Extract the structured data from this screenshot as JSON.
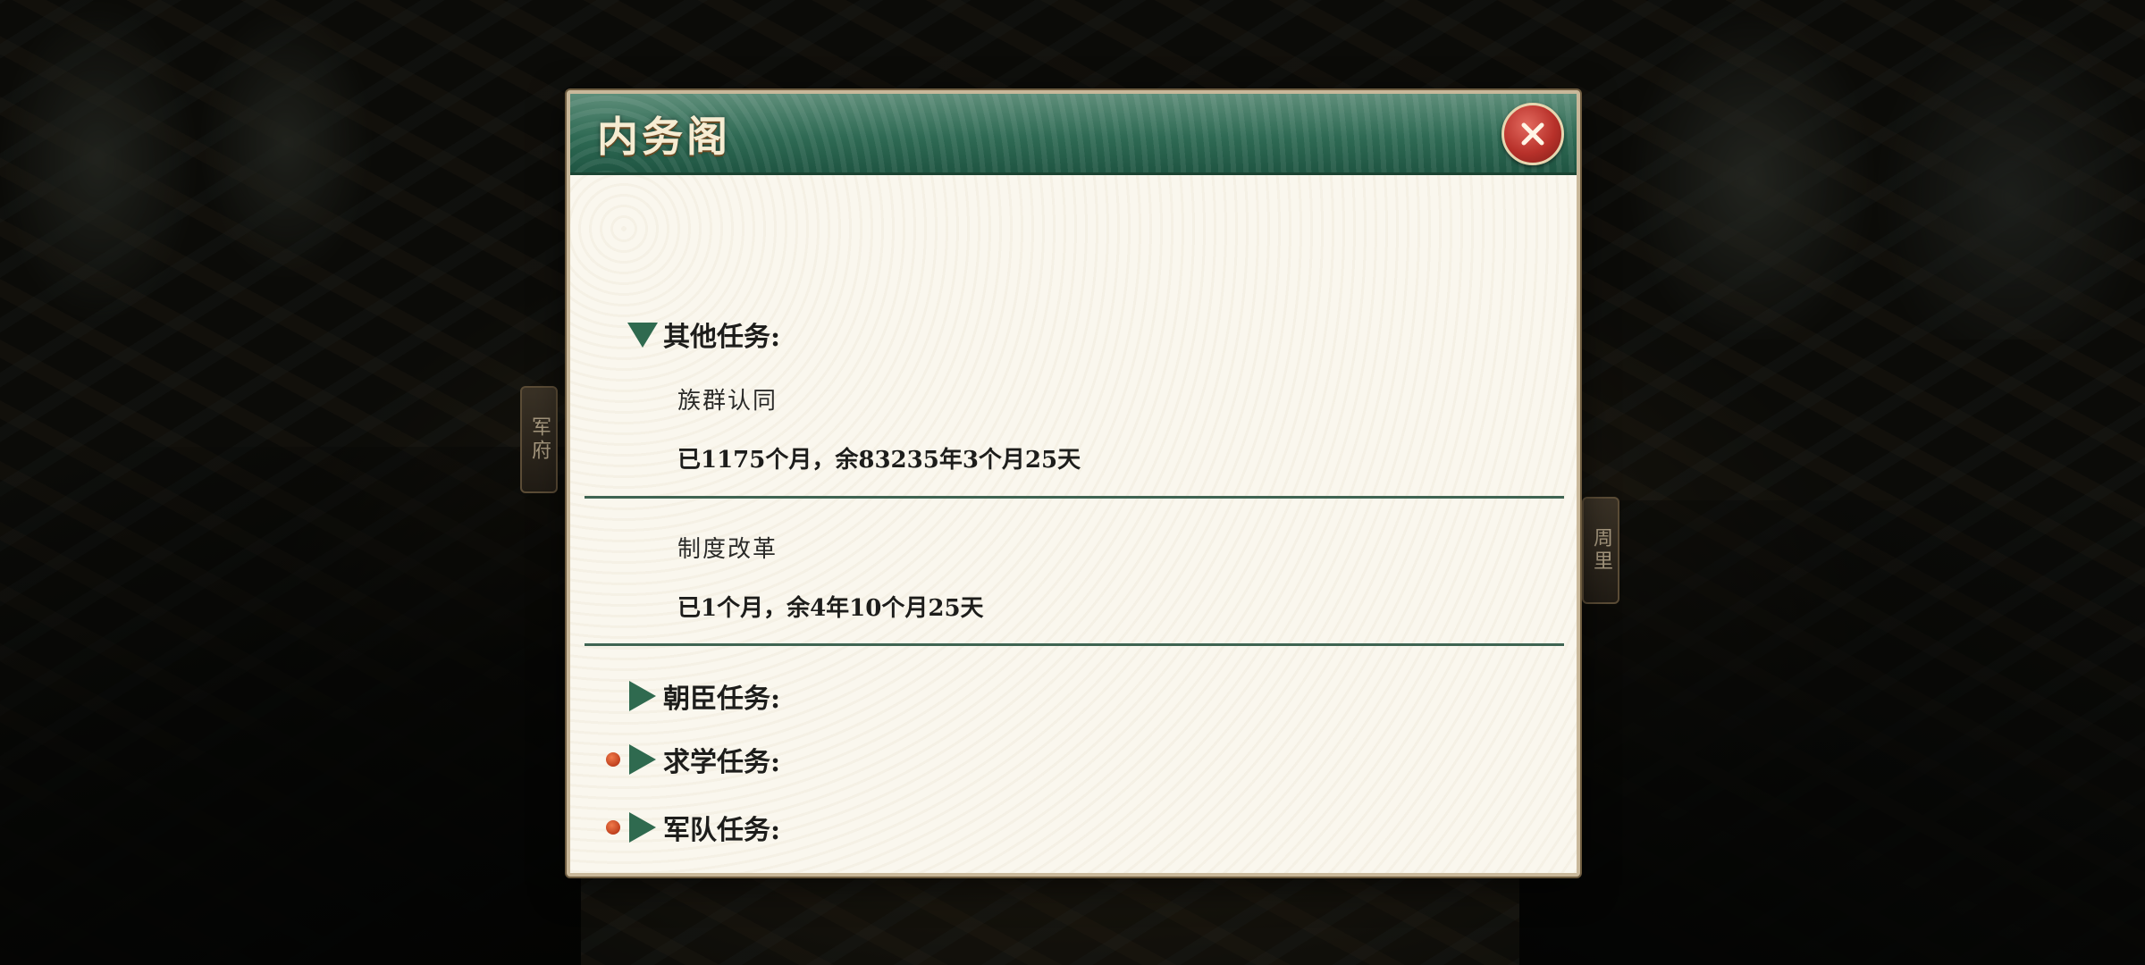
{
  "modal": {
    "title": "内务阁",
    "close_icon": "close-icon"
  },
  "side_tags": {
    "left": "军府",
    "right": "周里"
  },
  "sections": [
    {
      "label": "其他任务:",
      "state": "expanded",
      "has_dot": false,
      "tasks": [
        {
          "name": "族群认同",
          "progress": "已1175个月，余83235年3个月25天"
        },
        {
          "name": "制度改革",
          "progress": "已1个月，余4年10个月25天"
        }
      ]
    },
    {
      "label": "朝臣任务:",
      "state": "collapsed",
      "has_dot": false
    },
    {
      "label": "求学任务:",
      "state": "collapsed",
      "has_dot": true
    },
    {
      "label": "军队任务:",
      "state": "collapsed",
      "has_dot": true
    }
  ],
  "colors": {
    "header_green": "#2f6a54",
    "arrow_green": "#2f6a4f",
    "notice_dot": "#c0401d",
    "close_red": "#b8312a"
  }
}
